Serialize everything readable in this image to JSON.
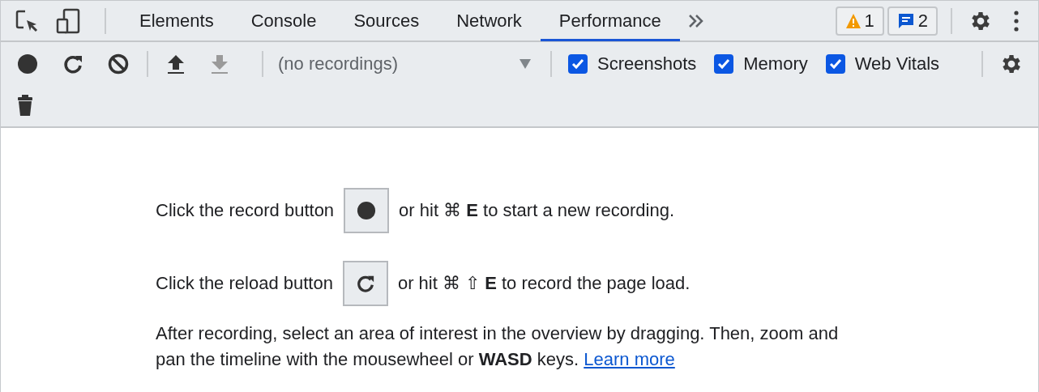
{
  "main_tabs": [
    {
      "label": "Elements",
      "selected": false
    },
    {
      "label": "Console",
      "selected": false
    },
    {
      "label": "Sources",
      "selected": false
    },
    {
      "label": "Network",
      "selected": false
    },
    {
      "label": "Performance",
      "selected": true
    }
  ],
  "issue_badges": [
    {
      "kind": "warning",
      "count": "1"
    },
    {
      "kind": "message",
      "count": "2"
    }
  ],
  "toolbar_buttons": [
    {
      "kind": "record",
      "disabled": false
    },
    {
      "kind": "reload",
      "disabled": false
    },
    {
      "kind": "clear",
      "disabled": false
    },
    {
      "kind": "upload",
      "disabled": false
    },
    {
      "kind": "download",
      "disabled": true
    }
  ],
  "recording_select": {
    "value": "(no recordings)"
  },
  "checkboxes": [
    {
      "label": "Screenshots",
      "checked": true
    },
    {
      "label": "Memory",
      "checked": true
    },
    {
      "label": "Web Vitals",
      "checked": true
    }
  ],
  "instructions": [
    {
      "before": "Click the record button",
      "kind": "record",
      "after": "or hit ⌘ **E** to start a new recording."
    },
    {
      "before": "Click the reload button",
      "kind": "reload",
      "after": "or hit ⌘ ⇧ **E** to record the page load."
    }
  ],
  "hint": {
    "text": "After recording, select an area of interest in the overview by dragging. Then, zoom and pan the timeline with the mousewheel or **WASD** keys.",
    "link": "Learn more"
  }
}
